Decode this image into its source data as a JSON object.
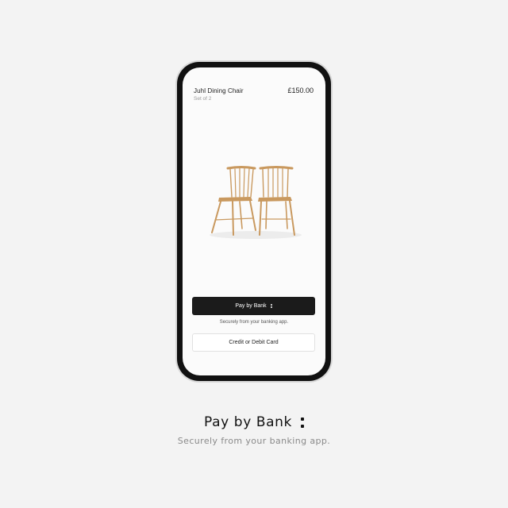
{
  "product": {
    "title": "Juhl Dining Chair",
    "subtitle": "Set of 2",
    "price": "£150.00",
    "image": "wooden-dining-chairs"
  },
  "checkout": {
    "pay_by_bank_label": "Pay by Bank",
    "secure_note": "Securely from your banking app.",
    "card_label": "Credit or Debit Card"
  },
  "hero": {
    "heading": "Pay by Bank",
    "subtext": "Securely from your banking app."
  },
  "colors": {
    "background": "#f3f3f3",
    "phone_frame": "#111111",
    "primary_button": "#1b1b1b",
    "chair_wood": "#c9995f"
  }
}
